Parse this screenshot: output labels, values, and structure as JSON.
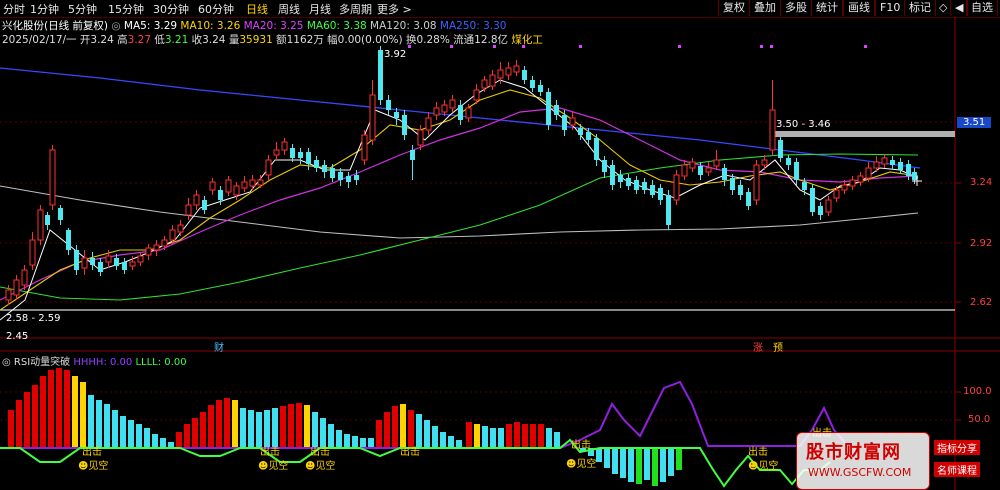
{
  "periods": [
    "分时",
    "1分钟",
    "5分钟",
    "15分钟",
    "30分钟",
    "60分钟",
    "日线",
    "周线",
    "月线",
    "多周期",
    "更多 >"
  ],
  "active_period": "日线",
  "toolbar": [
    "复权",
    "叠加",
    "多股",
    "统计",
    "画线",
    "F10",
    "标记",
    "◇",
    "◀",
    "自选"
  ],
  "stock": {
    "name": "兴化股份(日线 前复权)",
    "dot": "◎"
  },
  "ma": [
    {
      "label": "MA5: 3.29",
      "color": "#ffffff"
    },
    {
      "label": "MA10: 3.26",
      "color": "#ffd400"
    },
    {
      "label": "MA20: 3.25",
      "color": "#e040ff"
    },
    {
      "label": "MA60: 3.38",
      "color": "#40ff40"
    },
    {
      "label": "MA120: 3.08",
      "color": "#cccccc"
    },
    {
      "label": "MA250: 3.30",
      "color": "#4060ff"
    }
  ],
  "quote": {
    "date": "2025/02/17/一",
    "open_label": "开",
    "open": "3.24",
    "high_label": "高",
    "high": "3.27",
    "low_label": "低",
    "low": "3.21",
    "close_label": "收",
    "close": "3.24",
    "vol_label": "量",
    "vol": "35931",
    "amt": "额1162万",
    "chg": "幅0.00(0.00%)",
    "turnover": "换0.28%",
    "float": "流通12.8亿",
    "sector": "煤化工"
  },
  "price_axis": [
    "3.51",
    "3.24",
    "2.92",
    "2.62"
  ],
  "price_axis_highlight": "3.51",
  "annotations": {
    "peak": "3.92",
    "range": "3.50 - 3.46",
    "low_range": "2.58 - 2.59",
    "low": "2.45"
  },
  "event_tags": {
    "fin": "财",
    "zhang": "涨",
    "yu": "预"
  },
  "indicator": {
    "name": "RSI动量突破",
    "h_label": "HHHH: 0.00",
    "l_label": "LLLL: 0.00",
    "axis": [
      "100.0",
      "50.0"
    ]
  },
  "signals": {
    "out": "出击",
    "empty": "见空"
  },
  "watermark": {
    "title": "股市财富网",
    "url": "WWW.GSCFW.COM",
    "tag1": "指标分享",
    "tag2": "名师课程"
  },
  "colors": {
    "up": "#ff3030",
    "down": "#50e8f0",
    "bg": "#000000",
    "border": "#8a0000"
  }
}
